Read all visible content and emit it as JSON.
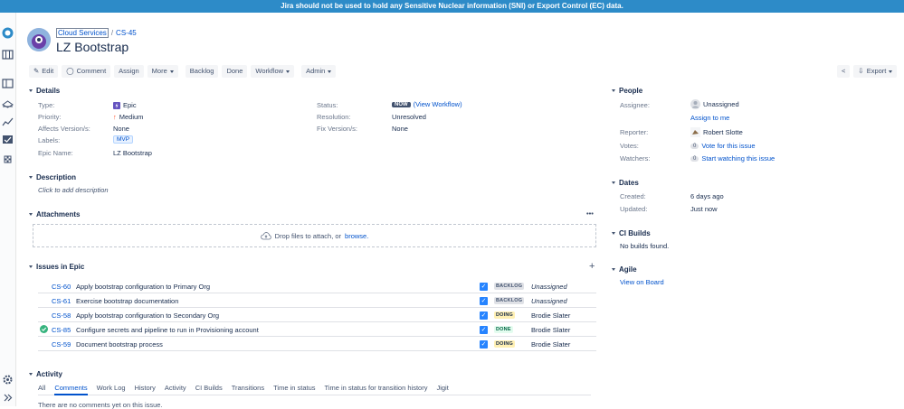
{
  "banner": "Jira should not be used to hold any Sensitive Nuclear information (SNI) or Export Control (EC) data.",
  "breadcrumb": {
    "project": "Cloud Services",
    "issue_key": "CS-45"
  },
  "title": "LZ Bootstrap",
  "toolbar": {
    "edit": "Edit",
    "comment": "Comment",
    "assign": "Assign",
    "more": "More",
    "backlog": "Backlog",
    "done": "Done",
    "workflow": "Workflow",
    "admin": "Admin",
    "export": "Export"
  },
  "details": {
    "heading": "Details",
    "type_label": "Type:",
    "type_value": "Epic",
    "priority_label": "Priority:",
    "priority_value": "Medium",
    "affects_label": "Affects Version/s:",
    "affects_value": "None",
    "labels_label": "Labels:",
    "labels_value": "MVP",
    "epicname_label": "Epic Name:",
    "epicname_value": "LZ Bootstrap",
    "status_label": "Status:",
    "status_badge": "NOW",
    "status_link": "(View Workflow)",
    "resolution_label": "Resolution:",
    "resolution_value": "Unresolved",
    "fix_label": "Fix Version/s:",
    "fix_value": "None"
  },
  "description": {
    "heading": "Description",
    "placeholder": "Click to add description"
  },
  "attachments": {
    "heading": "Attachments",
    "drop_text": "Drop files to attach, or",
    "browse": "browse."
  },
  "issues_in_epic": {
    "heading": "Issues in Epic",
    "rows": [
      {
        "key": "CS-60",
        "summary": "Apply bootstrap configuration to Primary Org",
        "status": "BACKLOG",
        "assignee": "Unassigned",
        "resolved": false
      },
      {
        "key": "CS-61",
        "summary": "Exercise bootstrap documentation",
        "status": "BACKLOG",
        "assignee": "Unassigned",
        "resolved": false
      },
      {
        "key": "CS-58",
        "summary": "Apply bootstrap configuration to Secondary Org",
        "status": "DOING",
        "assignee": "Brodie Slater",
        "resolved": false
      },
      {
        "key": "CS-85",
        "summary": "Configure secrets and pipeline to run in Provisioning account",
        "status": "DONE",
        "assignee": "Brodie Slater",
        "resolved": true
      },
      {
        "key": "CS-59",
        "summary": "Document bootstrap process",
        "status": "DOING",
        "assignee": "Brodie Slater",
        "resolved": false
      }
    ]
  },
  "activity": {
    "heading": "Activity",
    "tabs": [
      "All",
      "Comments",
      "Work Log",
      "History",
      "Activity",
      "CI Builds",
      "Transitions",
      "Time in status",
      "Time in status for transition history",
      "Jigit"
    ],
    "active_tab": "Comments",
    "empty_text": "There are no comments yet on this issue."
  },
  "people": {
    "heading": "People",
    "assignee_label": "Assignee:",
    "assignee_value": "Unassigned",
    "assign_to_me": "Assign to me",
    "reporter_label": "Reporter:",
    "reporter_value": "Robert Slotte",
    "votes_label": "Votes:",
    "votes_count": "0",
    "votes_link": "Vote for this issue",
    "watchers_label": "Watchers:",
    "watchers_count": "0",
    "watchers_link": "Start watching this issue"
  },
  "dates": {
    "heading": "Dates",
    "created_label": "Created:",
    "created_value": "6 days ago",
    "updated_label": "Updated:",
    "updated_value": "Just now"
  },
  "ci_builds": {
    "heading": "CI Builds",
    "text": "No builds found."
  },
  "agile": {
    "heading": "Agile",
    "link": "View on Board"
  },
  "colors": {
    "banner": "#2d8bc8",
    "link": "#0052cc",
    "checkbox": "#2684ff"
  }
}
